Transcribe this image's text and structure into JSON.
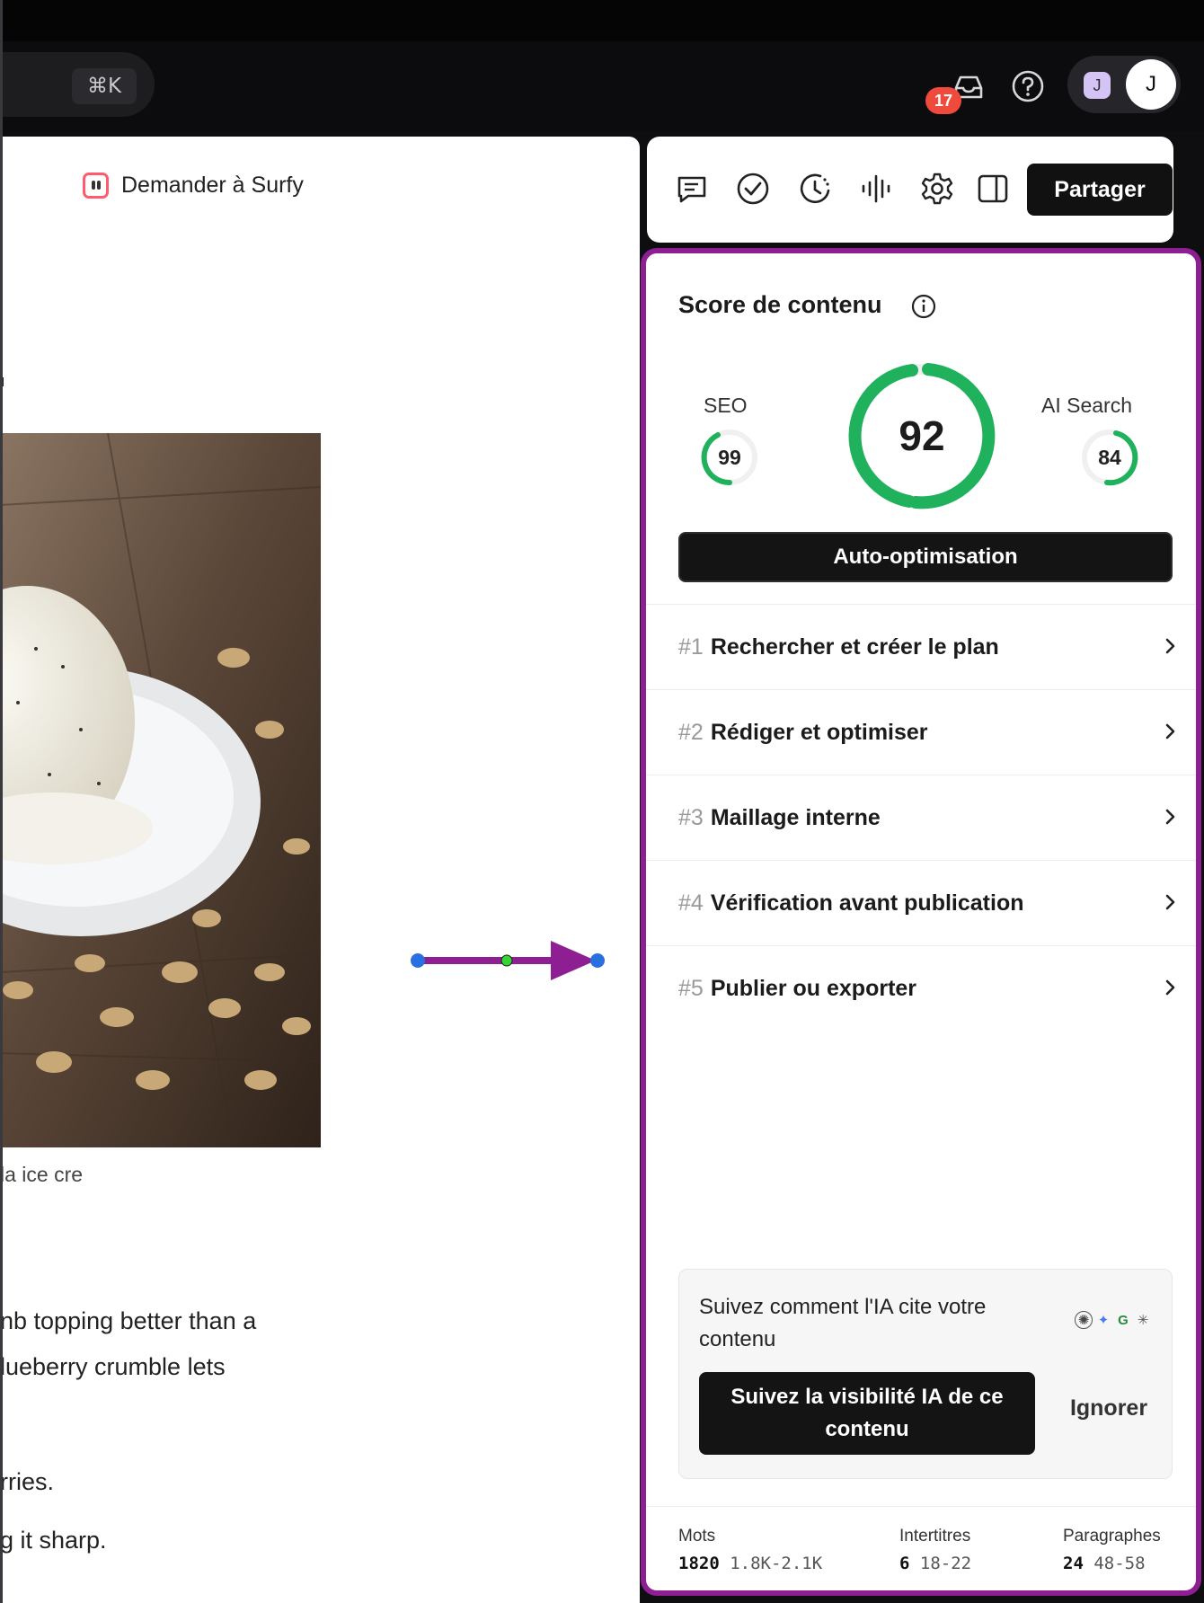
{
  "topbar": {
    "shortcut": "⌘K",
    "notification_count": "17",
    "avatar_small": "J",
    "avatar_big": "J"
  },
  "editor": {
    "ask_surfy": "Demander à Surfy",
    "image_caption": "la ice cre",
    "paragraphs": [
      "nb topping better than a",
      "lueberry crumble lets",
      "rries.",
      "g it sharp."
    ]
  },
  "toolbar": {
    "share_label": "Partager"
  },
  "score": {
    "title": "Score de contenu",
    "seo_label": "SEO",
    "seo_value": "99",
    "main_value": "92",
    "ai_label": "AI Search",
    "ai_value": "84",
    "auto_button": "Auto-optimisation",
    "accent_color": "#1fb15c"
  },
  "steps": [
    {
      "num": "#1",
      "label": "Rechercher et créer le plan"
    },
    {
      "num": "#2",
      "label": "Rédiger et optimiser"
    },
    {
      "num": "#3",
      "label": "Maillage interne"
    },
    {
      "num": "#4",
      "label": "Vérification avant publication"
    },
    {
      "num": "#5",
      "label": "Publier ou exporter"
    }
  ],
  "promo": {
    "text": "Suivez comment l'IA cite votre contenu",
    "track_button": "Suivez la visibilité IA de ce contenu",
    "ignore_button": "Ignorer"
  },
  "stats": {
    "words_label": "Mots",
    "words_value": "1820",
    "words_range": "1.8K-2.1K",
    "headings_label": "Intertitres",
    "headings_value": "6",
    "headings_range": "18-22",
    "paragraphs_label": "Paragraphes",
    "paragraphs_value": "24",
    "paragraphs_range": "48-58"
  }
}
